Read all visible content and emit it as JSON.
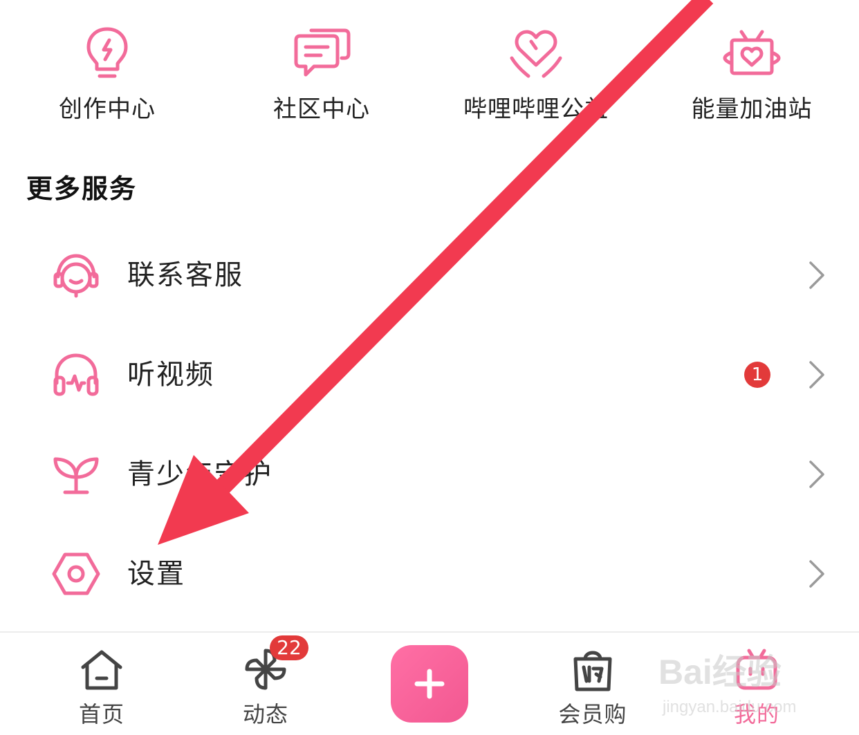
{
  "top_grid": {
    "items": [
      {
        "label": "创作中心",
        "icon": "lightbulb-icon"
      },
      {
        "label": "社区中心",
        "icon": "chat-bubbles-icon"
      },
      {
        "label": "哔哩哔哩公益",
        "icon": "heart-hands-icon"
      },
      {
        "label": "能量加油站",
        "icon": "tv-heart-icon"
      }
    ]
  },
  "more_services": {
    "title": "更多服务",
    "items": [
      {
        "label": "联系客服",
        "icon": "headset-agent-icon"
      },
      {
        "label": "听视频",
        "icon": "headphones-icon",
        "badge": "1"
      },
      {
        "label": "青少年守护",
        "icon": "sprout-icon"
      },
      {
        "label": "设置",
        "icon": "hex-nut-gear-icon"
      }
    ]
  },
  "tabbar": {
    "tabs": [
      {
        "label": "首页",
        "icon": "home-icon"
      },
      {
        "label": "动态",
        "icon": "pinwheel-icon",
        "badge": "22"
      },
      {
        "label": "",
        "icon": "plus-icon"
      },
      {
        "label": "会员购",
        "icon": "shopping-bag-icon"
      },
      {
        "label": "我的",
        "icon": "tv-mine-icon",
        "active": true
      }
    ]
  },
  "overlay": {
    "arrow_color": "#f23a50",
    "watermark_main": "Bai经验",
    "watermark_sub": "jingyan.baidu.com"
  },
  "colors": {
    "accent_pink": "#f26b9a",
    "badge_red": "#e23a3a",
    "text_dark": "#222222"
  }
}
